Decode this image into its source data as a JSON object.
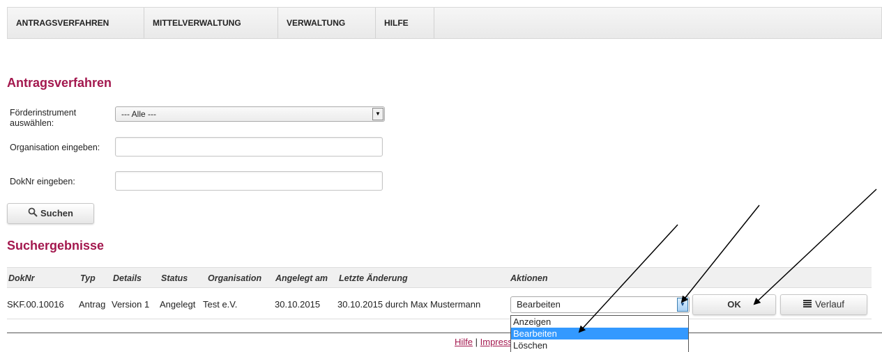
{
  "nav": {
    "items": [
      {
        "label": "ANTRAGSVERFAHREN"
      },
      {
        "label": "MITTELVERWALTUNG"
      },
      {
        "label": "VERWALTUNG"
      },
      {
        "label": "HILFE"
      }
    ]
  },
  "page_title": "Antragsverfahren",
  "form": {
    "instrument_label": "Förderinstrument auswählen:",
    "instrument_value": "--- Alle ---",
    "organisation_label": "Organisation eingeben:",
    "organisation_value": "",
    "doknr_label": "DokNr eingeben:",
    "doknr_value": "",
    "search_label": "Suchen"
  },
  "results_title": "Suchergebnisse",
  "table": {
    "headers": {
      "doknr": "DokNr",
      "typ": "Typ",
      "details": "Details",
      "status": "Status",
      "organisation": "Organisation",
      "angelegt": "Angelegt am",
      "aenderung": "Letzte Änderung",
      "aktionen": "Aktionen"
    },
    "rows": [
      {
        "doknr": "SKF.00.10016",
        "typ": "Antrag",
        "details": "Version 1",
        "status": "Angelegt",
        "organisation": "Test e.V.",
        "angelegt": "30.10.2015",
        "aenderung": "30.10.2015 durch Max Mustermann",
        "aktion_selected": "Bearbeiten",
        "ok_label": "OK",
        "verlauf_label": "Verlauf"
      }
    ]
  },
  "dropdown_options": [
    "Anzeigen",
    "Bearbeiten",
    "Löschen"
  ],
  "footer": {
    "hilfe": "Hilfe",
    "separator": " | ",
    "impressum": "Impressu"
  },
  "colors": {
    "accent": "#a3184e",
    "selection": "#3399ff"
  }
}
